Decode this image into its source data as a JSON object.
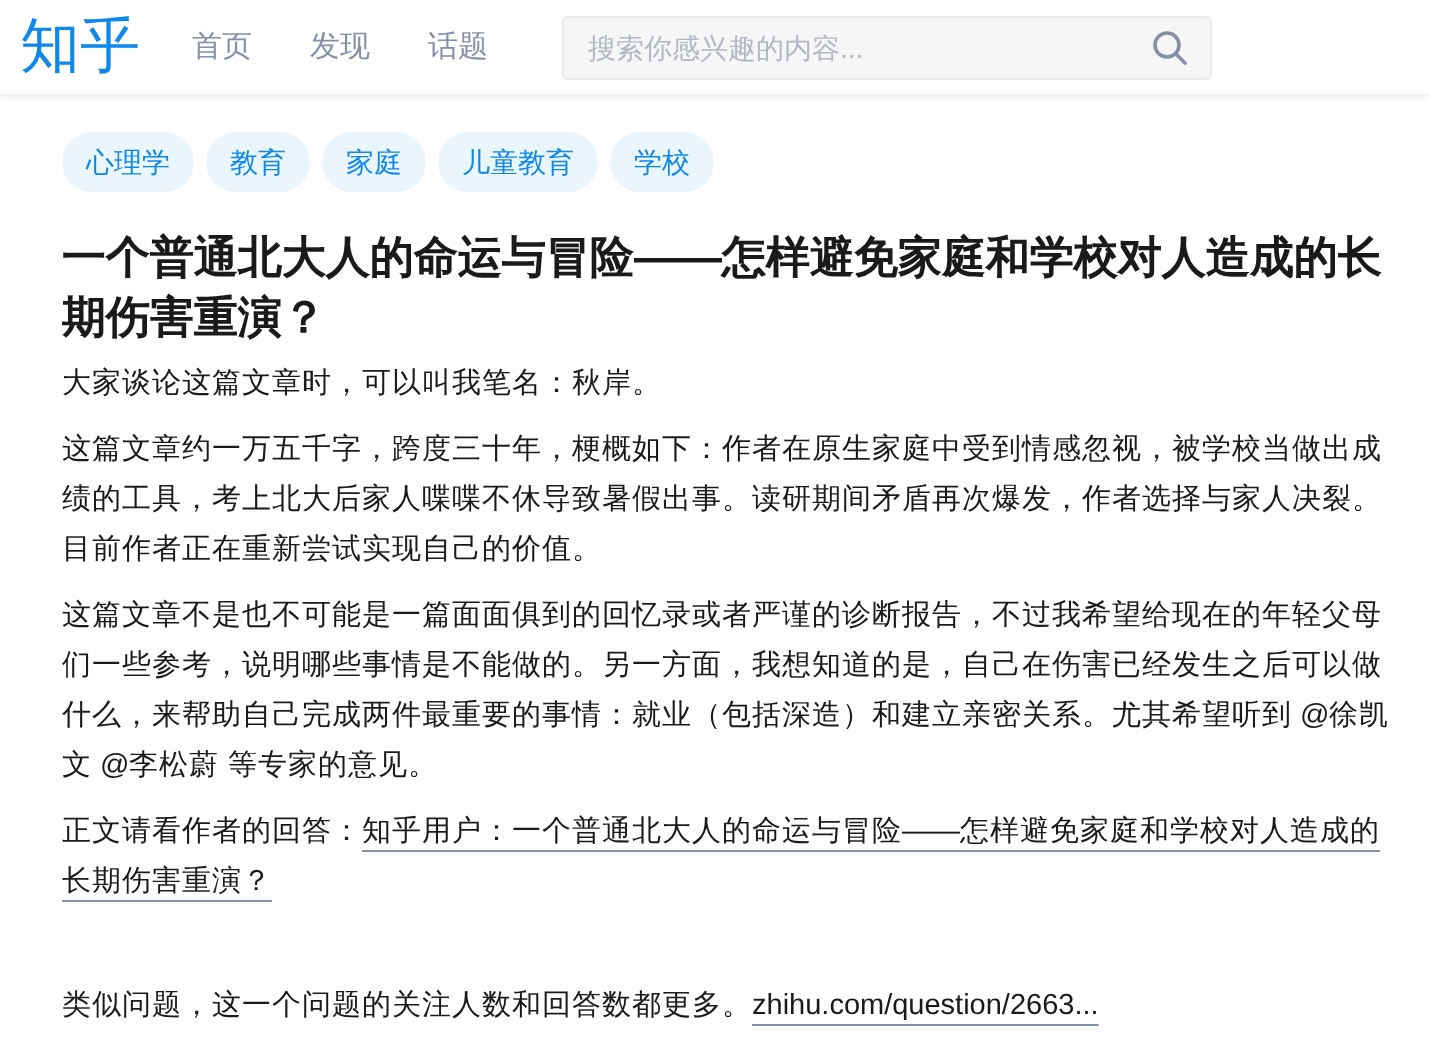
{
  "header": {
    "logo": "知乎",
    "nav": [
      {
        "label": "首页",
        "selected": false
      },
      {
        "label": "发现",
        "selected": false
      },
      {
        "label": "话题",
        "selected": false
      }
    ],
    "search": {
      "placeholder": "搜索你感兴趣的内容..."
    }
  },
  "tags": [
    "心理学",
    "教育",
    "家庭",
    "儿童教育",
    "学校"
  ],
  "title": "一个普通北大人的命运与冒险——怎样避免家庭和学校对人造成的长期伤害重演？",
  "paragraphs": [
    {
      "text": "大家谈论这篇文章时，可以叫我笔名：秋岸。"
    },
    {
      "text": "这篇文章约一万五千字，跨度三十年，梗概如下：作者在原生家庭中受到情感忽视，被学校当做出成绩的工具，考上北大后家人喋喋不休导致暑假出事。读研期间矛盾再次爆发，作者选择与家人决裂。目前作者正在重新尝试实现自己的价值。"
    },
    {
      "text": "这篇文章不是也不可能是一篇面面俱到的回忆录或者严谨的诊断报告，不过我希望给现在的年轻父母们一些参考，说明哪些事情是不能做的。另一方面，我想知道的是，自己在伤害已经发生之后可以做什么，来帮助自己完成两件最重要的事情：就业（包括深造）和建立亲密关系。尤其希望听到 @徐凯文 @李松蔚 等专家的意见。"
    },
    {
      "text": "正文请看作者的回答：",
      "link": "知乎用户：一个普通北大人的命运与冒险——怎样避免家庭和学校对人造成的长期伤害重演？"
    },
    {
      "text": "类似问题，这一个问题的关注人数和回答数都更多。",
      "link": "zhihu.com/question/2663..."
    }
  ]
}
